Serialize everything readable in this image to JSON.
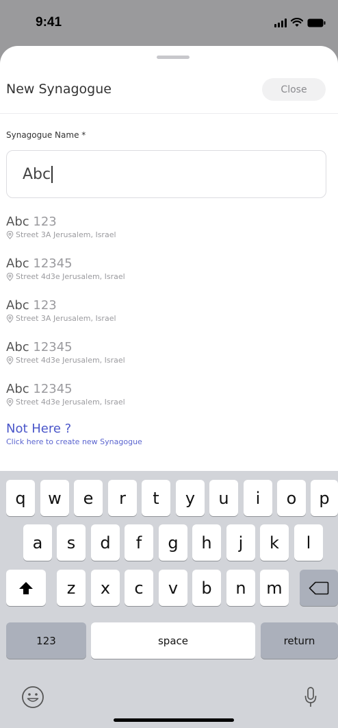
{
  "status_bar": {
    "time": "9:41"
  },
  "sheet": {
    "title": "New Synagogue",
    "close_label": "Close",
    "field_label": "Synagogue Name *",
    "input_value": "Abc"
  },
  "results": [
    {
      "match": "Abc",
      "rest": " 123",
      "address": "Street 3A Jerusalem, Israel"
    },
    {
      "match": "Abc",
      "rest": " 12345",
      "address": "Street 4d3e Jerusalem, Israel"
    },
    {
      "match": "Abc",
      "rest": " 123",
      "address": "Street 3A Jerusalem, Israel"
    },
    {
      "match": "Abc",
      "rest": " 12345",
      "address": "Street 4d3e Jerusalem, Israel"
    },
    {
      "match": "Abc",
      "rest": " 12345",
      "address": "Street 4d3e Jerusalem, Israel"
    }
  ],
  "not_here": {
    "title": "Not Here ?",
    "subtitle": "Click here to create new Synagogue"
  },
  "keyboard": {
    "row1": [
      "q",
      "w",
      "e",
      "r",
      "t",
      "y",
      "u",
      "i",
      "o",
      "p"
    ],
    "row2": [
      "a",
      "s",
      "d",
      "f",
      "g",
      "h",
      "j",
      "k",
      "l"
    ],
    "row3": [
      "z",
      "x",
      "c",
      "v",
      "b",
      "n",
      "m"
    ],
    "numbers_label": "123",
    "space_label": "space",
    "return_label": "return"
  },
  "icons": {
    "shift": "shift-icon",
    "backspace": "backspace-icon",
    "emoji": "emoji-icon",
    "mic": "microphone-icon",
    "location": "location-pin-icon"
  },
  "colors": {
    "accent": "#4a56c9",
    "sheet_background": "#ffffff",
    "keyboard_background": "#d2d4d9"
  }
}
